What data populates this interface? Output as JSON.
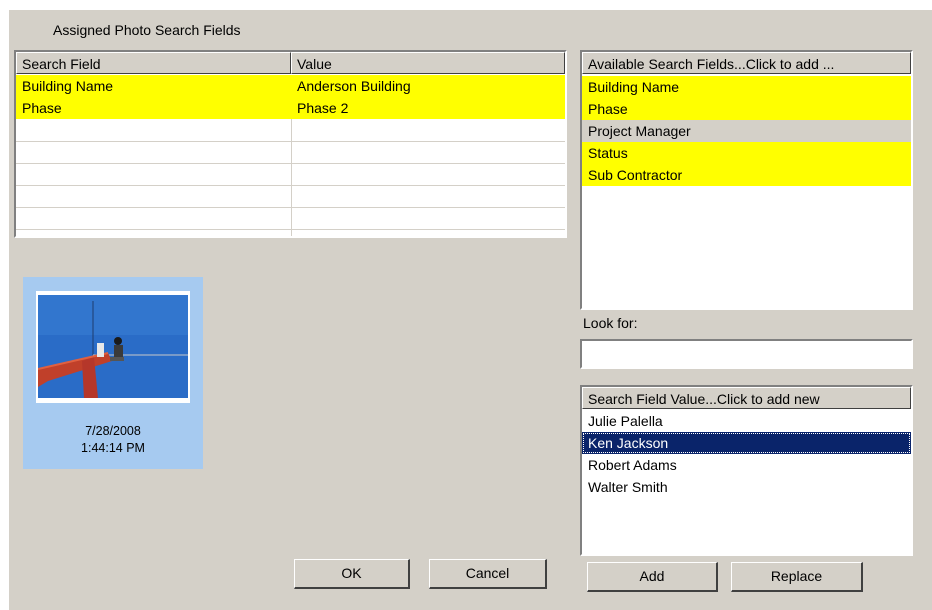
{
  "dialog": {
    "assigned_group_label": "Assigned Photo Search Fields"
  },
  "assigned_table": {
    "columns": [
      "Search Field",
      "Value"
    ],
    "rows": [
      {
        "field": "Building Name",
        "value": "Anderson Building"
      },
      {
        "field": "Phase",
        "value": "Phase 2"
      }
    ],
    "row_highlight_color": "#ffff00"
  },
  "available_fields": {
    "header": "Available Search Fields...Click to add ...",
    "items": [
      "Building Name",
      "Phase",
      "Project Manager",
      "Status",
      "Sub Contractor"
    ],
    "highlighted": [
      true,
      true,
      false,
      true,
      true
    ],
    "highlight_color": "#ffff00",
    "unhighlighted_color": "#d4d0c8"
  },
  "look_for": {
    "label": "Look for:",
    "value": ""
  },
  "field_values": {
    "header": "Search Field Value...Click to add new",
    "items": [
      "Julie Palella",
      "Ken Jackson",
      "Robert Adams",
      "Walter Smith"
    ],
    "selected_index": 1,
    "selected_color": "#0a246a"
  },
  "thumbnail": {
    "date": "7/28/2008",
    "time": "1:44:14 PM"
  },
  "buttons": {
    "ok": "OK",
    "cancel": "Cancel",
    "add": "Add",
    "replace": "Replace"
  }
}
